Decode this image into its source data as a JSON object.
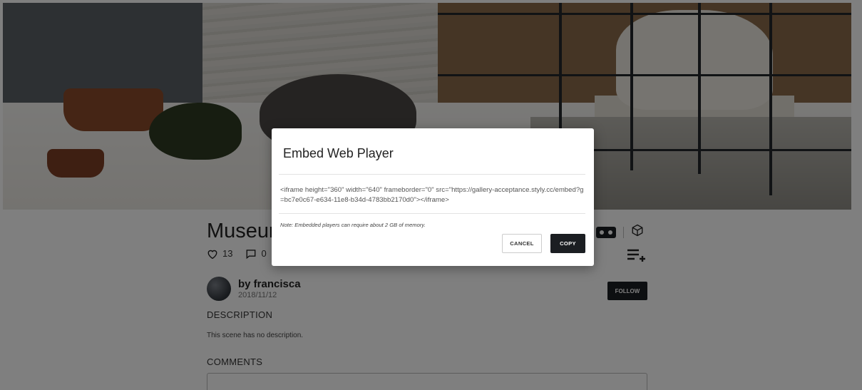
{
  "scene": {
    "title": "Museum",
    "likes": "13",
    "comments_count": "0",
    "author": {
      "name": "by francisca",
      "date": "2018/11/12"
    },
    "follow_label": "FOLLOW",
    "description_heading": "DESCRIPTION",
    "description_text": "This scene has no description.",
    "comments_heading": "COMMENTS"
  },
  "modal": {
    "title": "Embed Web Player",
    "embed_code": "<iframe height=\"360\" width=\"640\" frameborder=\"0\" src=\"https://gallery-acceptance.styly.cc/embed?g=bc7e0c67-e634-11e8-b34d-4783bb2170d0\"></iframe>",
    "note": "Note: Embedded players can require about 2 GB of memory.",
    "cancel_label": "CANCEL",
    "copy_label": "COPY"
  },
  "icons": {
    "like": "heart-icon",
    "comment": "comment-icon",
    "vr": "vr-headset-icon",
    "object": "cube-icon",
    "playlist": "playlist-add-icon"
  },
  "colors": {
    "primary_dark": "#1b1e22",
    "overlay": "rgba(0,0,0,0.5)"
  }
}
